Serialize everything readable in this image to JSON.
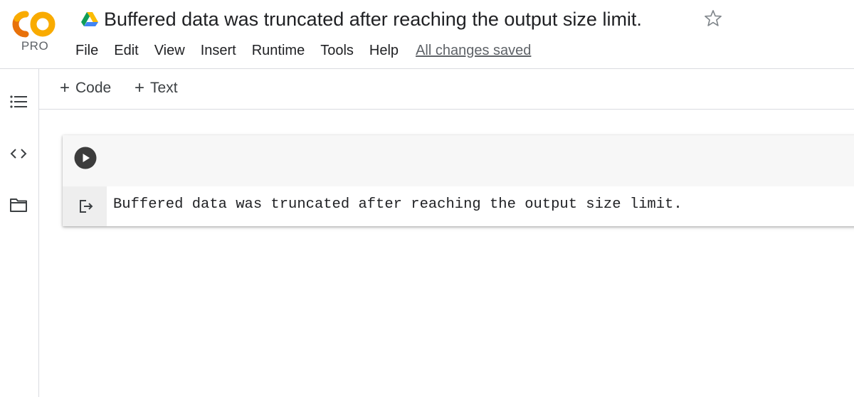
{
  "app": {
    "logo_text": "CO",
    "logo_sub": "PRO",
    "doc_title": "Buffered data was truncated after reaching the output size limit.",
    "colors": {
      "logo_orange": "#F9AB00",
      "logo_orange_dark": "#E8710A",
      "text": "#202124",
      "muted": "#5f6368",
      "border": "#dadce0"
    }
  },
  "menu": {
    "items": [
      {
        "label": "File"
      },
      {
        "label": "Edit"
      },
      {
        "label": "View"
      },
      {
        "label": "Insert"
      },
      {
        "label": "Runtime"
      },
      {
        "label": "Tools"
      },
      {
        "label": "Help"
      }
    ],
    "save_status": "All changes saved"
  },
  "sidebar": {
    "icons": [
      "table-of-contents-icon",
      "code-snippets-icon",
      "files-folder-icon"
    ]
  },
  "toolbar": {
    "add_code_label": "Code",
    "add_text_label": "Text",
    "plus_glyph": "+"
  },
  "cell": {
    "output_text": "Buffered data was truncated after reaching the output size limit."
  }
}
